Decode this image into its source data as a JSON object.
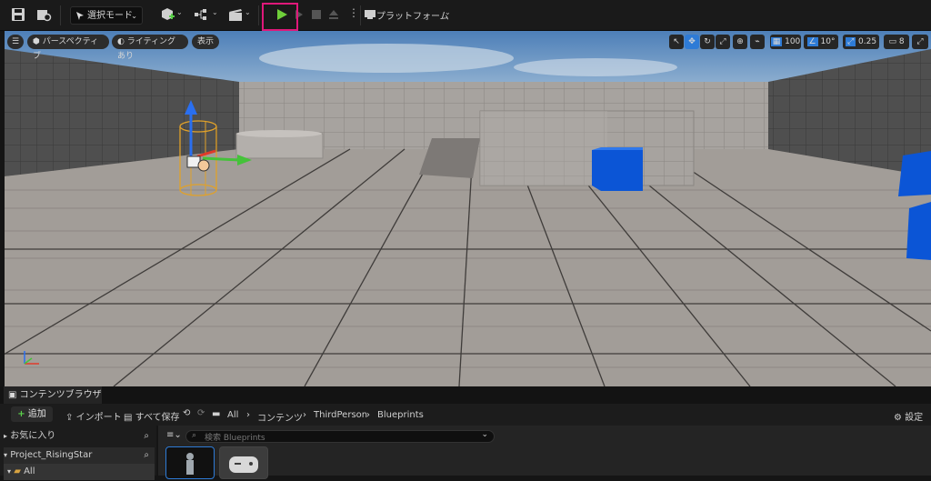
{
  "toolbar": {
    "mode_label": "選択モード",
    "platform_label": "プラットフォーム"
  },
  "viewport": {
    "perspective_label": "パースペクティブ",
    "lighting_label": "ライティングあり",
    "show_label": "表示",
    "grid_snap_value": "100",
    "rotation_snap_value": "10°",
    "scale_snap_value": "0.25",
    "camera_speed_value": "8"
  },
  "content_browser": {
    "tab_label": "コンテンツブラウザ",
    "add_label": "追加",
    "import_label": "インポート",
    "save_all_label": "すべて保存",
    "breadcrumb": [
      "All",
      "コンテンツ",
      "ThirdPerson",
      "Blueprints"
    ],
    "settings_label": "設定",
    "favorites_label": "お気に入り",
    "project_label": "Project_RisingStar",
    "all_label": "All",
    "search_placeholder": "検索 Blueprints"
  },
  "colors": {
    "highlight": "#e0187a",
    "play_green": "#6fcf3a",
    "accent_blue": "#2e7bd6"
  }
}
